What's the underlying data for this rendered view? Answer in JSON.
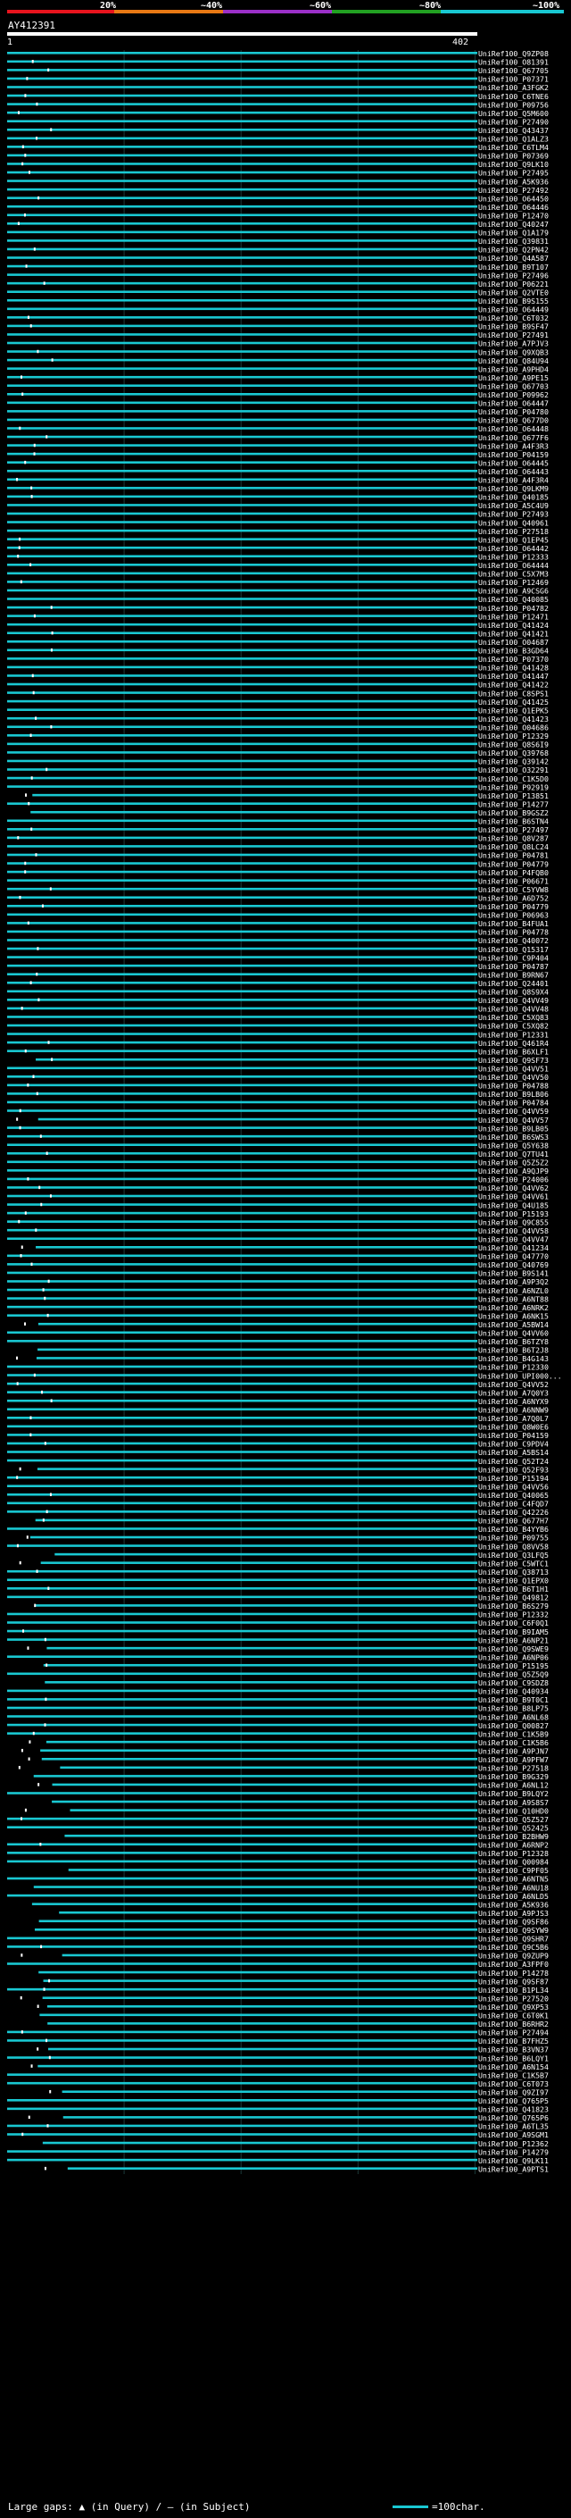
{
  "query_id": "AY412391",
  "ruler": {
    "start": "1",
    "end": "402"
  },
  "footer": {
    "legend_text": "Large gaps: ▲ (in Query) / – (in Subject)",
    "scale_label": "=100char."
  },
  "chart_data": {
    "type": "alignment_overview",
    "title": "AY412391",
    "query_length": 402,
    "identity_scale": {
      "labels": [
        "20%",
        "~40%",
        "~60%",
        "~80%",
        "~100%"
      ],
      "colors": [
        "#e8141e",
        "#e87814",
        "#9b30c8",
        "#22a022",
        "#19c8d2"
      ]
    },
    "hits": [
      "UniRef100_Q9ZP08",
      "UniRef100_O81391",
      "UniRef100_Q67705",
      "UniRef100_P07371",
      "UniRef100_A3FGK2",
      "UniRef100_C6TNE6",
      "UniRef100_P09756",
      "UniRef100_Q5M600",
      "UniRef100_P27490",
      "UniRef100_Q43437",
      "UniRef100_Q1ALZ3",
      "UniRef100_C6TLM4",
      "UniRef100_P07369",
      "UniRef100_Q9LK10",
      "UniRef100_P27495",
      "UniRef100_A5K936",
      "UniRef100_P27492",
      "UniRef100_O64450",
      "UniRef100_O64446",
      "UniRef100_P12470",
      "UniRef100_Q40247",
      "UniRef100_Q1A179",
      "UniRef100_Q39831",
      "UniRef100_Q2PN42",
      "UniRef100_Q4A587",
      "UniRef100_B9T107",
      "UniRef100_P27496",
      "UniRef100_P06221",
      "UniRef100_Q2VTE0",
      "UniRef100_B9S155",
      "UniRef100_O64449",
      "UniRef100_C6T032",
      "UniRef100_B9SF47",
      "UniRef100_P27491",
      "UniRef100_A7PJV3",
      "UniRef100_Q9XQB3",
      "UniRef100_Q84U94",
      "UniRef100_A9PHD4",
      "UniRef100_A9PE15",
      "UniRef100_Q67703",
      "UniRef100_P09962",
      "UniRef100_O64447",
      "UniRef100_P04780",
      "UniRef100_Q677D0",
      "UniRef100_O64448",
      "UniRef100_Q677F6",
      "UniRef100_A4F3R3",
      "UniRef100_P04159",
      "UniRef100_O64445",
      "UniRef100_O64443",
      "UniRef100_A4F3R4",
      "UniRef100_Q9LKM9",
      "UniRef100_Q40185",
      "UniRef100_A5C4U9",
      "UniRef100_P27493",
      "UniRef100_Q40961",
      "UniRef100_P27518",
      "UniRef100_Q1EP45",
      "UniRef100_O64442",
      "UniRef100_P12333",
      "UniRef100_O64444",
      "UniRef100_C5X7M3",
      "UniRef100_P12469",
      "UniRef100_A9CSG6",
      "UniRef100_Q40085",
      "UniRef100_P04782",
      "UniRef100_P12471",
      "UniRef100_Q41424",
      "UniRef100_Q41421",
      "UniRef100_O04687",
      "UniRef100_B3GD64",
      "UniRef100_P07370",
      "UniRef100_Q41428",
      "UniRef100_O41447",
      "UniRef100_Q41422",
      "UniRef100_C8SPS1",
      "UniRef100_Q41425",
      "UniRef100_Q1EPK5",
      "UniRef100_Q41423",
      "UniRef100_O04686",
      "UniRef100_P12329",
      "UniRef100_Q8S6I9",
      "UniRef100_Q39768",
      "UniRef100_Q39142",
      "UniRef100_O32291",
      "UniRef100_C1K5D0",
      "UniRef100_P92919",
      "UniRef100_P13851",
      "UniRef100_P14277",
      "UniRef100_B9GSZ2",
      "UniRef100_B6STN4",
      "UniRef100_P27497",
      "UniRef100_Q8V287",
      "UniRef100_Q8LC24",
      "UniRef100_P04781",
      "UniRef100_P04779",
      "UniRef100_P4FQB0",
      "UniRef100_P06671",
      "UniRef100_C5YVW8",
      "UniRef100_A6D752",
      "UniRef100_P04779",
      "UniRef100_P06963",
      "UniRef100_B4FUA1",
      "UniRef100_P04778",
      "UniRef100_Q40072",
      "UniRef100_Q15317",
      "UniRef100_C9P404",
      "UniRef100_P04787",
      "UniRef100_B9RN67",
      "UniRef100_Q24401",
      "UniRef100_Q8S9X4",
      "UniRef100_Q4VV49",
      "UniRef100_Q4VV48",
      "UniRef100_C5XQ83",
      "UniRef100_C5XQ82",
      "UniRef100_P12331",
      "UniRef100_Q461R4",
      "UniRef100_B6XLF1",
      "UniRef100_Q9SF73",
      "UniRef100_Q4VV51",
      "UniRef100_Q4VV50",
      "UniRef100_P04788",
      "UniRef100_B9LB06",
      "UniRef100_P04784",
      "UniRef100_Q4VV59",
      "UniRef100_Q4VV57",
      "UniRef100_B9LB05",
      "UniRef100_B6SWS3",
      "UniRef100_Q5Y638",
      "UniRef100_Q7TU41",
      "UniRef100_Q5Z5Z2",
      "UniRef100_A9QJP9",
      "UniRef100_P24006",
      "UniRef100_Q4VV62",
      "UniRef100_Q4VV61",
      "UniRef100_Q4U185",
      "UniRef100_P15193",
      "UniRef100_Q9C855",
      "UniRef100_Q4VV58",
      "UniRef100_Q4VV47",
      "UniRef100_Q41234",
      "UniRef100_Q47770",
      "UniRef100_Q40769",
      "UniRef100_B9S141",
      "UniRef100_A9P3Q2",
      "UniRef100_A6NZL0",
      "UniRef100_A6NT88",
      "UniRef100_A6NRK2",
      "UniRef100_A6NK15",
      "UniRef100_A5BW14",
      "UniRef100_Q4VV60",
      "UniRef100_B6TZY8",
      "UniRef100_B6T2J8",
      "UniRef100_B4G143",
      "UniRef100_P12330",
      "UniRef100_UPI000...",
      "UniRef100_Q4VV52",
      "UniRef100_A7Q0Y3",
      "UniRef100_A6NYX9",
      "UniRef100_A6NNW9",
      "UniRef100_A7Q0L7",
      "UniRef100_Q8W0E6",
      "UniRef100_P04159",
      "UniRef100_C9PDV4",
      "UniRef100_A5BS14",
      "UniRef100_Q52T24",
      "UniRef100_Q52F93",
      "UniRef100_P15194",
      "UniRef100_Q4VV56",
      "UniRef100_Q40065",
      "UniRef100_C4FQD7",
      "UniRef100_Q42226",
      "UniRef100_Q677H7",
      "UniRef100_B4YYB6",
      "UniRef100_P09755",
      "UniRef100_Q8VV58",
      "UniRef100_Q3LFQ5",
      "UniRef100_C5WTC1",
      "UniRef100_Q38713",
      "UniRef100_Q1EPX0",
      "UniRef100_B6T1H1",
      "UniRef100_Q49812",
      "UniRef100_B6S279",
      "UniRef100_P12332",
      "UniRef100_C6F0Q1",
      "UniRef100_B9IAM5",
      "UniRef100_A6NP21",
      "UniRef100_Q9SWE9",
      "UniRef100_A6NP06",
      "UniRef100_P15195",
      "UniRef100_Q5Z5Q9",
      "UniRef100_C9SDZ8",
      "UniRef100_Q40934",
      "UniRef100_B9T0C1",
      "UniRef100_B8LP75",
      "UniRef100_A6NL68",
      "UniRef100_Q00827",
      "UniRef100_C1K5B9",
      "UniRef100_C1K5B6",
      "UniRef100_A9PJN7",
      "UniRef100_A9PFW7",
      "UniRef100_P27518",
      "UniRef100_B9G329",
      "UniRef100_A6NL12",
      "UniRef100_B9LQY2",
      "UniRef100_A9S8S7",
      "UniRef100_Q10HD0",
      "UniRef100_Q5Z527",
      "UniRef100_Q52425",
      "UniRef100_B2BHW9",
      "UniRef100_A6RNP2",
      "UniRef100_P12328",
      "UniRef100_Q00984",
      "UniRef100_C9PF05",
      "UniRef100_A6NTN5",
      "UniRef100_A6NU18",
      "UniRef100_A6NLD5",
      "UniRef100_A5K936",
      "UniRef100_A9PJS3",
      "UniRef100_Q9SF86",
      "UniRef100_Q9SYW9",
      "UniRef100_Q9SHR7",
      "UniRef100_Q9C5B6",
      "UniRef100_Q9ZUP9",
      "UniRef100_A3FPF0",
      "UniRef100_P14278",
      "UniRef100_Q9SF87",
      "UniRef100_B1PL34",
      "UniRef100_P27520",
      "UniRef100_Q9XP53",
      "UniRef100_C6T0K1",
      "UniRef100_B6RHR2",
      "UniRef100_P27494",
      "UniRef100_B7FHZ5",
      "UniRef100_B3VN37",
      "UniRef100_B6LQY1",
      "UniRef100_A6N154",
      "UniRef100_C1K5B7",
      "UniRef100_C6T073",
      "UniRef100_Q9ZI97",
      "UniRef100_Q765P5",
      "UniRef100_Q41823",
      "UniRef100_Q765P6",
      "UniRef100_A6TL35",
      "UniRef100_A9SGM1",
      "UniRef100_P12362",
      "UniRef100_P14279",
      "UniRef100_Q9LK11",
      "UniRef100_A9PTS1"
    ]
  }
}
